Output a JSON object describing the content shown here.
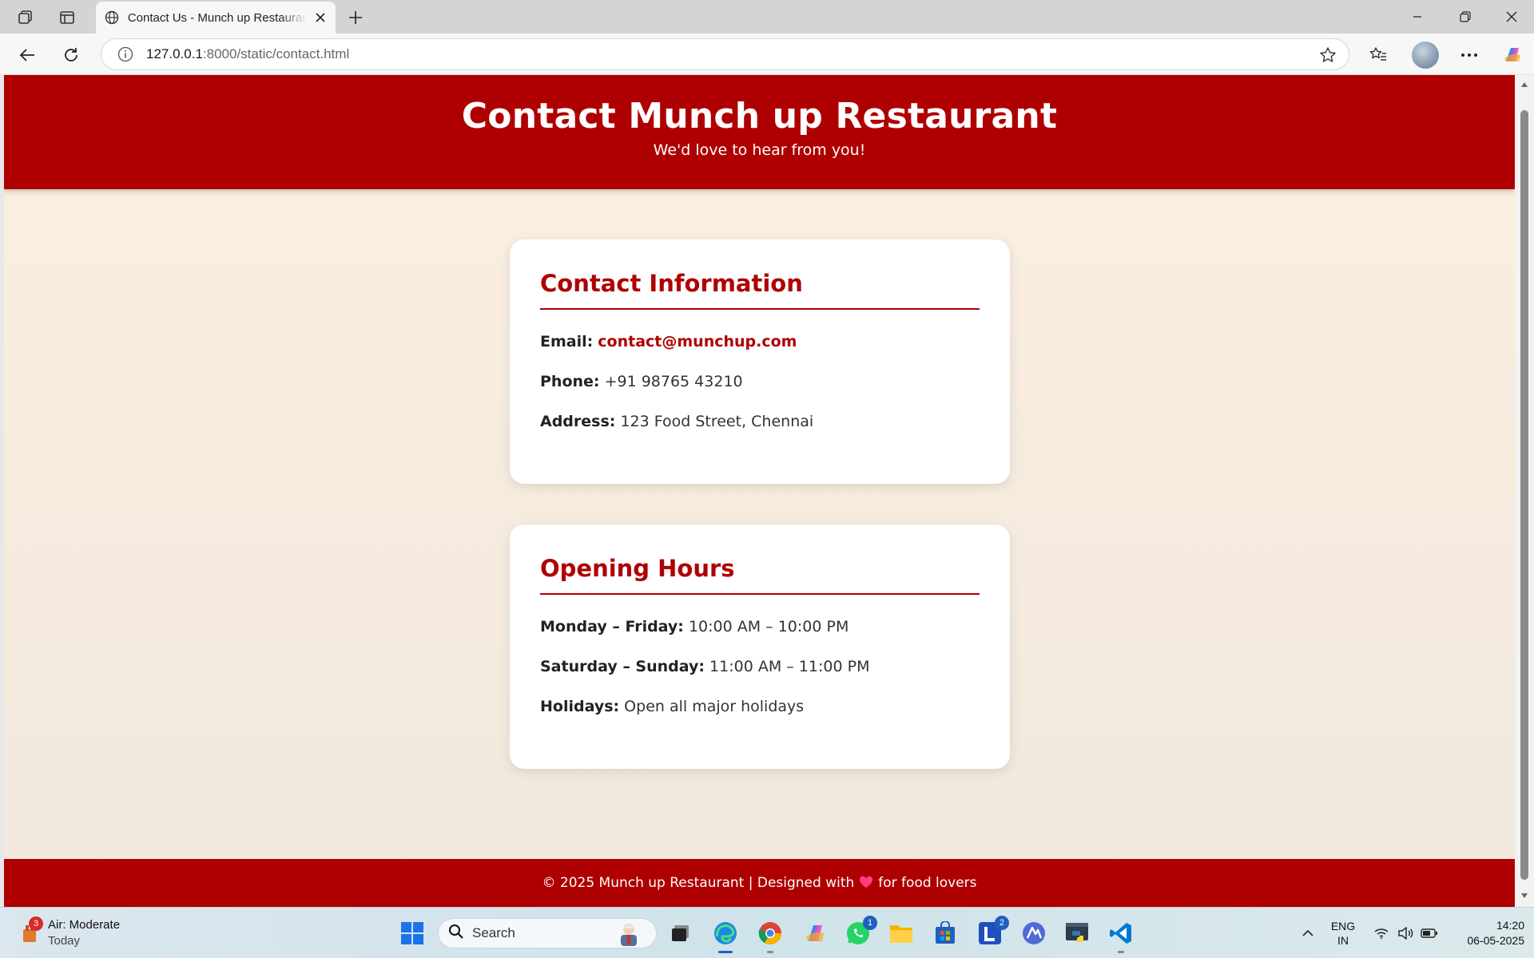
{
  "browser": {
    "tab_title": "Contact Us - Munch up Restaurant",
    "url_host": "127.0.0.1",
    "url_rest": ":8000/static/contact.html"
  },
  "page": {
    "title": "Contact Munch up Restaurant",
    "subtitle": "We'd love to hear from you!",
    "contact": {
      "heading": "Contact Information",
      "email_label": "Email:",
      "email_value": "contact@munchup.com",
      "phone_label": "Phone:",
      "phone_value": "+91 98765 43210",
      "address_label": "Address:",
      "address_value": "123 Food Street, Chennai"
    },
    "hours": {
      "heading": "Opening Hours",
      "weekday_label": "Monday – Friday:",
      "weekday_value": "10:00 AM – 10:00 PM",
      "weekend_label": "Saturday – Sunday:",
      "weekend_value": "11:00 AM – 11:00 PM",
      "holiday_label": "Holidays:",
      "holiday_value": "Open all major holidays"
    },
    "footer": {
      "left": "© 2025 Munch up Restaurant | Designed with",
      "right": "for food lovers"
    }
  },
  "taskbar": {
    "weather_badge": "3",
    "weather_title": "Air: Moderate",
    "weather_sub": "Today",
    "search_placeholder": "Search",
    "whatsapp_badge": "1",
    "l_badge": "2",
    "lang_top": "ENG",
    "lang_bottom": "IN",
    "time": "14:20",
    "date": "06-05-2025"
  },
  "colors": {
    "brand_red": "#ae0000",
    "page_bg": "#fbefdf",
    "heart": "#ff3d7f"
  }
}
